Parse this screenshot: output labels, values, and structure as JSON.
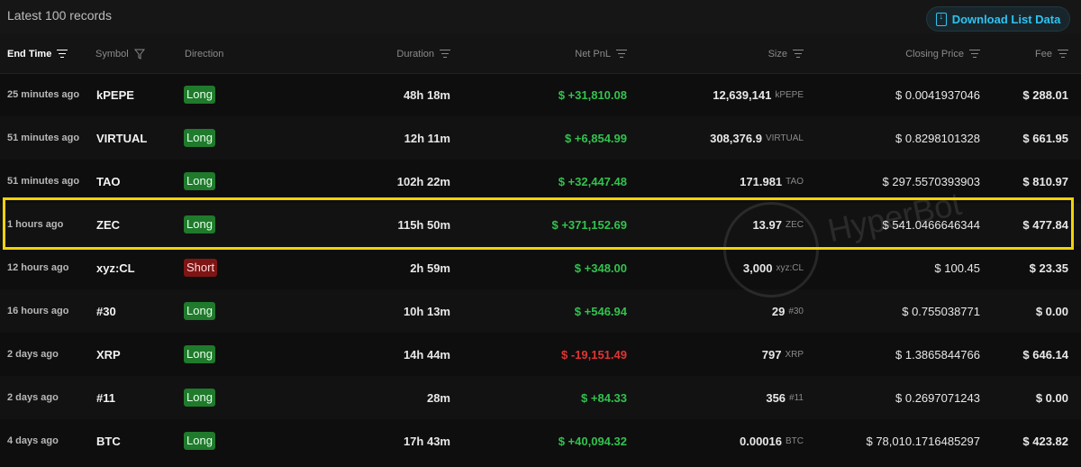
{
  "header": {
    "title": "Latest 100 records",
    "download_label": "Download List Data"
  },
  "columns": {
    "end_time": "End Time",
    "symbol": "Symbol",
    "direction": "Direction",
    "duration": "Duration",
    "net_pnl": "Net PnL",
    "size": "Size",
    "closing_price": "Closing Price",
    "fee": "Fee"
  },
  "rows": [
    {
      "time": "25 minutes ago",
      "symbol": "kPEPE",
      "direction": "Long",
      "duration": "48h 18m",
      "pnl": "$ +31,810.08",
      "size": "12,639,141",
      "unit": "kPEPE",
      "price": "$ 0.0041937046",
      "fee": "$ 288.01"
    },
    {
      "time": "51 minutes ago",
      "symbol": "VIRTUAL",
      "direction": "Long",
      "duration": "12h 11m",
      "pnl": "$ +6,854.99",
      "size": "308,376.9",
      "unit": "VIRTUAL",
      "price": "$ 0.8298101328",
      "fee": "$ 661.95"
    },
    {
      "time": "51 minutes ago",
      "symbol": "TAO",
      "direction": "Long",
      "duration": "102h 22m",
      "pnl": "$ +32,447.48",
      "size": "171.981",
      "unit": "TAO",
      "price": "$ 297.5570393903",
      "fee": "$ 810.97"
    },
    {
      "time": "1 hours ago",
      "symbol": "ZEC",
      "direction": "Long",
      "duration": "115h 50m",
      "pnl": "$ +371,152.69",
      "size": "13.97",
      "unit": "ZEC",
      "price": "$ 541.0466646344",
      "fee": "$ 477.84"
    },
    {
      "time": "12 hours ago",
      "symbol": "xyz:CL",
      "direction": "Short",
      "duration": "2h 59m",
      "pnl": "$ +348.00",
      "size": "3,000",
      "unit": "xyz:CL",
      "price": "$ 100.45",
      "fee": "$ 23.35"
    },
    {
      "time": "16 hours ago",
      "symbol": "#30",
      "direction": "Long",
      "duration": "10h 13m",
      "pnl": "$ +546.94",
      "size": "29",
      "unit": "#30",
      "price": "$ 0.755038771",
      "fee": "$ 0.00"
    },
    {
      "time": "2 days ago",
      "symbol": "XRP",
      "direction": "Long",
      "duration": "14h 44m",
      "pnl": "$ -19,151.49",
      "size": "797",
      "unit": "XRP",
      "price": "$ 1.3865844766",
      "fee": "$ 646.14"
    },
    {
      "time": "2 days ago",
      "symbol": "#11",
      "direction": "Long",
      "duration": "28m",
      "pnl": "$ +84.33",
      "size": "356",
      "unit": "#11",
      "price": "$ 0.2697071243",
      "fee": "$ 0.00"
    },
    {
      "time": "4 days ago",
      "symbol": "BTC",
      "direction": "Long",
      "duration": "17h 43m",
      "pnl": "$ +40,094.32",
      "size": "0.00016",
      "unit": "BTC",
      "price": "$ 78,010.1716485297",
      "fee": "$ 423.82"
    }
  ],
  "watermark": "HyperBot",
  "colors": {
    "accent": "#2ec3f0",
    "positive": "#32c24e",
    "negative": "#e03434",
    "long_badge": "#1f7a2c",
    "short_badge": "#7d1515",
    "highlight": "#f2d20b"
  }
}
